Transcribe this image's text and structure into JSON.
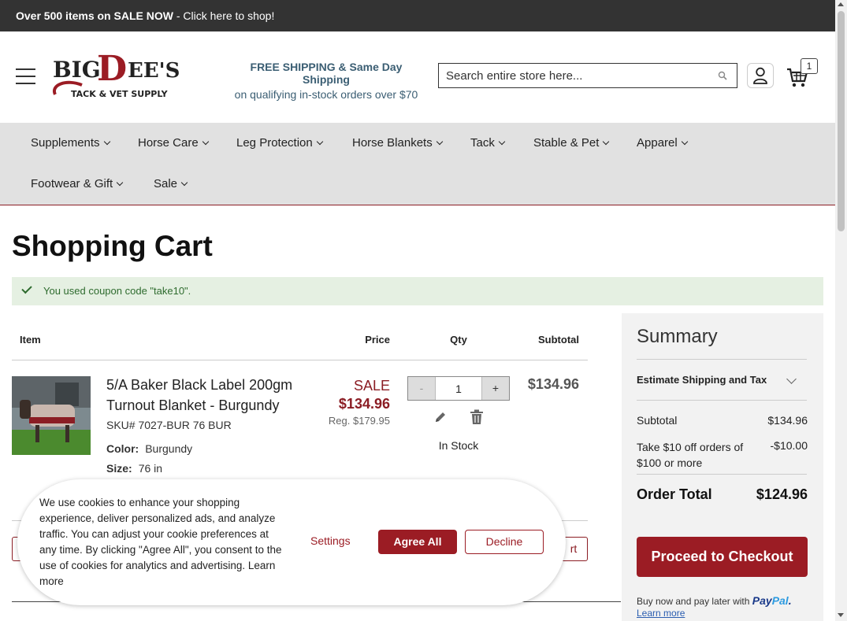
{
  "promo": {
    "bold": "Over 500 items on SALE NOW",
    "rest": " - Click here to shop!"
  },
  "header": {
    "logo_text": "BIG DEE'S",
    "logo_sub": "TACK & VET SUPPLY",
    "shipping_line1": "FREE SHIPPING & Same Day Shipping",
    "shipping_line2": "on qualifying in-stock orders over $70",
    "search_placeholder": "Search entire store here...",
    "cart_count": "1"
  },
  "nav": {
    "items": [
      {
        "label": "Supplements"
      },
      {
        "label": "Horse Care"
      },
      {
        "label": "Leg Protection"
      },
      {
        "label": "Horse Blankets"
      },
      {
        "label": "Tack"
      },
      {
        "label": "Stable & Pet"
      },
      {
        "label": "Apparel"
      },
      {
        "label": "Footwear & Gift"
      },
      {
        "label": "Sale"
      }
    ]
  },
  "page": {
    "title": "Shopping Cart",
    "notice": "You used coupon code \"take10\"."
  },
  "table": {
    "headers": {
      "item": "Item",
      "price": "Price",
      "qty": "Qty",
      "subtotal": "Subtotal"
    }
  },
  "product": {
    "name": "5/A Baker Black Label 200gm Turnout Blanket - Burgundy",
    "sku": "SKU# 7027-BUR 76 BUR",
    "options": [
      {
        "key": "Color:",
        "value": "Burgundy"
      },
      {
        "key": "Size:",
        "value": "76 in"
      }
    ],
    "sale_label": "SALE",
    "price": "$134.96",
    "reg_price": "Reg. $179.95",
    "qty": "1",
    "qty_minus": "-",
    "qty_plus": "+",
    "stock": "In Stock",
    "subtotal": "$134.96"
  },
  "actions": {
    "update_partial": "rt"
  },
  "summary": {
    "title": "Summary",
    "estimate": "Estimate Shipping and Tax",
    "subtotal_label": "Subtotal",
    "subtotal_value": "$134.96",
    "discount_label": "Take $10 off orders of $100 or more",
    "discount_value": "-$10.00",
    "total_label": "Order Total",
    "total_value": "$124.96",
    "checkout": "Proceed to Checkout",
    "paypal_text": "Buy now and pay later with",
    "paypal_brand1": "Pay",
    "paypal_brand2": "Pal",
    "paypal_dot": ".",
    "learn_more": "Learn more"
  },
  "cookie": {
    "text": "We use cookies to enhance your shopping experience, deliver personalized ads, and analyze traffic. You can adjust your cookie preferences at any time. By clicking \"Agree All\", you consent to the use of cookies for analytics and advertising. Learn more",
    "settings": "Settings",
    "agree": "Agree All",
    "decline": "Decline"
  },
  "colors": {
    "brand": "#9b1c24",
    "nav_bg": "#e1e1e1",
    "promo_bg": "#333333",
    "notice_bg": "#e5f0e2"
  }
}
